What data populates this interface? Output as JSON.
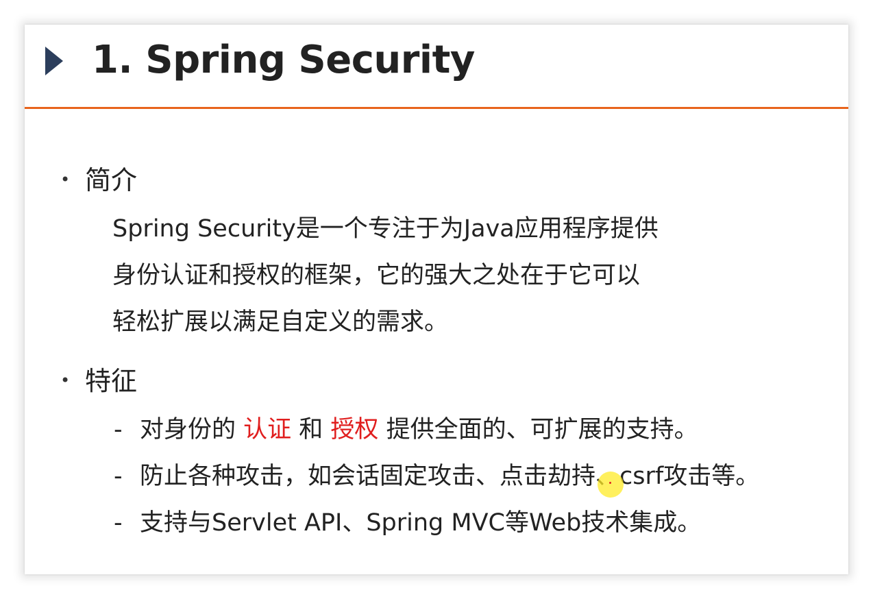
{
  "slide": {
    "title": "1. Spring Security",
    "intro": {
      "label": "简介",
      "lines": [
        "Spring Security是一个专注于为Java应用程序提供",
        "身份认证和授权的框架，它的强大之处在于它可以",
        "轻松扩展以满足自定义的需求。"
      ]
    },
    "features": {
      "label": "特征",
      "dash": "-",
      "items": [
        {
          "p1": "对身份的 ",
          "h1": "认证",
          "p2": " 和 ",
          "h2": "授权",
          "p3": " 提供全面的、可扩展的支持。"
        },
        {
          "text": "防止各种攻击，如会话固定攻击、点击劫持、csrf攻击等。"
        },
        {
          "text": "支持与Servlet API、Spring MVC等Web技术集成。"
        }
      ]
    }
  },
  "colors": {
    "accent_rule": "#e8641c",
    "triangle": "#2c3e5c",
    "highlight_text": "#e01e1e",
    "cursor_highlight": "#ffeb28"
  },
  "icons": {
    "header_marker": "play-triangle-icon",
    "pointer": "cursor-highlight-icon"
  }
}
